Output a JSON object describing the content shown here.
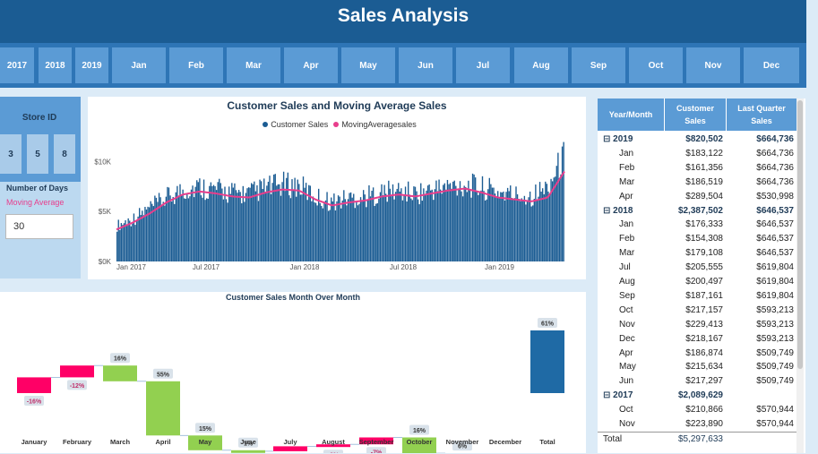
{
  "header": {
    "title": "Sales Analysis"
  },
  "slicers": {
    "items": [
      "2017",
      "2018",
      "2019",
      "Jan",
      "Feb",
      "Mar",
      "Apr",
      "May",
      "Jun",
      "Jul",
      "Aug",
      "Sep",
      "Oct",
      "Nov",
      "Dec"
    ]
  },
  "store": {
    "title": "Store ID",
    "items": [
      "3",
      "5",
      "8"
    ]
  },
  "days": {
    "title": "Number of Days",
    "subtitle": "Moving Average",
    "value": "30"
  },
  "colors": {
    "primary": "#1b5c93",
    "accent": "#5b9bd5",
    "moving_avg": "#e83e8c",
    "positive": "#92d050",
    "negative": "#ff0066",
    "total": "#1f6aa5"
  },
  "chart_data": [
    {
      "type": "bar",
      "title": "Customer Sales and Moving Average Sales",
      "legend": [
        "Customer Sales",
        "MovingAveragesales"
      ],
      "legend_position": "top-center",
      "y_ticks": [
        "$0K",
        "$5K",
        "$10K"
      ],
      "ylim": [
        0,
        12000
      ],
      "x_ticks": [
        "Jan 2017",
        "Jul 2017",
        "Jan 2018",
        "Jul 2018",
        "Jan 2019"
      ],
      "series": [
        {
          "name": "Customer Sales",
          "months": [
            "2017-01",
            "2017-02",
            "2017-03",
            "2017-04",
            "2017-05",
            "2017-06",
            "2017-07",
            "2017-08",
            "2017-09",
            "2017-10",
            "2017-11",
            "2017-12",
            "2018-01",
            "2018-02",
            "2018-03",
            "2018-04",
            "2018-05",
            "2018-06",
            "2018-07",
            "2018-08",
            "2018-09",
            "2018-10",
            "2018-11",
            "2018-12",
            "2019-01",
            "2019-02",
            "2019-03",
            "2019-04"
          ],
          "values": [
            3500,
            4200,
            5200,
            6200,
            7000,
            7300,
            7000,
            6700,
            6600,
            7200,
            7500,
            7400,
            6300,
            5800,
            6200,
            6300,
            6700,
            6900,
            6600,
            7000,
            7300,
            7500,
            7200,
            6800,
            6500,
            6400,
            7200,
            10200
          ]
        },
        {
          "name": "MovingAveragesales",
          "months": [
            "2017-01",
            "2017-02",
            "2017-03",
            "2017-04",
            "2017-05",
            "2017-06",
            "2017-07",
            "2017-08",
            "2017-09",
            "2017-10",
            "2017-11",
            "2017-12",
            "2018-01",
            "2018-02",
            "2018-03",
            "2018-04",
            "2018-05",
            "2018-06",
            "2018-07",
            "2018-08",
            "2018-09",
            "2018-10",
            "2018-11",
            "2018-12",
            "2019-01",
            "2019-02",
            "2019-03",
            "2019-04"
          ],
          "values": [
            3200,
            3900,
            4800,
            5900,
            6700,
            7000,
            6800,
            6500,
            6400,
            6900,
            7200,
            7100,
            6200,
            5600,
            5900,
            6100,
            6500,
            6700,
            6500,
            6800,
            7100,
            7300,
            6900,
            6400,
            6200,
            6000,
            6400,
            9000
          ]
        }
      ]
    },
    {
      "type": "bar",
      "title": "Customer Sales Month Over Month",
      "categories": [
        "January",
        "February",
        "March",
        "April",
        "May",
        "June",
        "July",
        "August",
        "September",
        "October",
        "November",
        "December",
        "Total"
      ],
      "values": [
        -16,
        -12,
        16,
        55,
        15,
        1,
        -5,
        -2,
        -7,
        16,
        6,
        -5,
        61
      ],
      "labels": [
        "-16%",
        "-12%",
        "16%",
        "55%",
        "15%",
        "1%",
        "-5%",
        "-2%",
        "-7%",
        "16%",
        "6%",
        "-5%",
        "61%"
      ]
    }
  ],
  "table": {
    "headers": [
      "Year/Month",
      "Customer Sales",
      "Last Quarter Sales"
    ],
    "rows": [
      {
        "label": "⊟ 2019",
        "sales": "$820,502",
        "lq": "$664,736",
        "year": true
      },
      {
        "label": "Jan",
        "sales": "$183,122",
        "lq": "$664,736"
      },
      {
        "label": "Feb",
        "sales": "$161,356",
        "lq": "$664,736"
      },
      {
        "label": "Mar",
        "sales": "$186,519",
        "lq": "$664,736"
      },
      {
        "label": "Apr",
        "sales": "$289,504",
        "lq": "$530,998"
      },
      {
        "label": "⊟ 2018",
        "sales": "$2,387,502",
        "lq": "$646,537",
        "year": true
      },
      {
        "label": "Jan",
        "sales": "$176,333",
        "lq": "$646,537"
      },
      {
        "label": "Feb",
        "sales": "$154,308",
        "lq": "$646,537"
      },
      {
        "label": "Mar",
        "sales": "$179,108",
        "lq": "$646,537"
      },
      {
        "label": "Jul",
        "sales": "$205,555",
        "lq": "$619,804"
      },
      {
        "label": "Aug",
        "sales": "$200,497",
        "lq": "$619,804"
      },
      {
        "label": "Sep",
        "sales": "$187,161",
        "lq": "$619,804"
      },
      {
        "label": "Oct",
        "sales": "$217,157",
        "lq": "$593,213"
      },
      {
        "label": "Nov",
        "sales": "$229,413",
        "lq": "$593,213"
      },
      {
        "label": "Dec",
        "sales": "$218,167",
        "lq": "$593,213"
      },
      {
        "label": "Apr",
        "sales": "$186,874",
        "lq": "$509,749"
      },
      {
        "label": "May",
        "sales": "$215,634",
        "lq": "$509,749"
      },
      {
        "label": "Jun",
        "sales": "$217,297",
        "lq": "$509,749"
      },
      {
        "label": "⊟ 2017",
        "sales": "$2,089,629",
        "lq": "",
        "year": true
      },
      {
        "label": "Oct",
        "sales": "$210,866",
        "lq": "$570,944"
      },
      {
        "label": "Nov",
        "sales": "$223,890",
        "lq": "$570,944"
      },
      {
        "label": "Total",
        "sales": "$5,297,633",
        "lq": "",
        "total": true
      }
    ]
  }
}
